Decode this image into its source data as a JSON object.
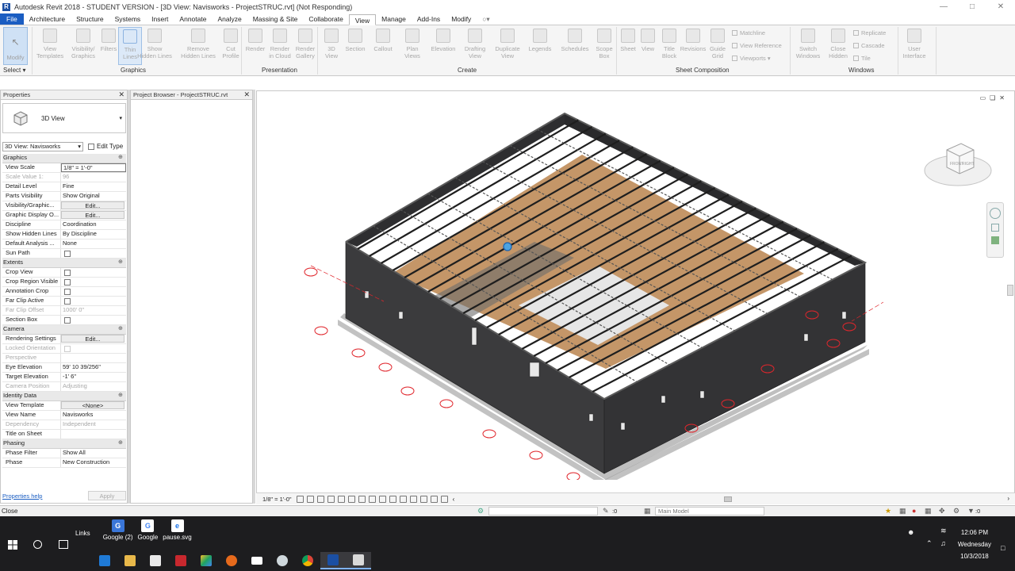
{
  "window": {
    "title": "Autodesk Revit 2018 - STUDENT VERSION - [3D View: Navisworks - ProjectSTRUC.rvt] (Not Responding)"
  },
  "ribbon_tabs": [
    "File",
    "Architecture",
    "Structure",
    "Systems",
    "Insert",
    "Annotate",
    "Analyze",
    "Massing & Site",
    "Collaborate",
    "View",
    "Manage",
    "Add-Ins",
    "Modify"
  ],
  "active_tab": "View",
  "ribbon": {
    "modify_label": "Modify",
    "select_label": "Select",
    "tools": {
      "view_templates": "View Templates",
      "visibility_graphics": "Visibility/ Graphics",
      "filters": "Filters",
      "thin_lines": "Thin Lines",
      "show_hidden_lines": "Show Hidden Lines",
      "remove_hidden_lines": "Remove Hidden Lines",
      "cut_profile": "Cut Profile",
      "render": "Render",
      "render_cloud": "Render in Cloud",
      "render_gallery": "Render Gallery",
      "view_3d": "3D View",
      "section": "Section",
      "callout": "Callout",
      "plan_views": "Plan Views",
      "elevation": "Elevation",
      "drafting_view": "Drafting View",
      "duplicate_view": "Duplicate View",
      "legends": "Legends",
      "schedules": "Schedules",
      "scope_box": "Scope Box",
      "sheet": "Sheet",
      "view": "View",
      "title_block": "Title Block",
      "revisions": "Revisions",
      "guide_grid": "Guide Grid",
      "matchline": "Matchline",
      "view_reference": "View Reference",
      "viewports": "Viewports",
      "switch_windows": "Switch Windows",
      "close_hidden": "Close Hidden",
      "replicate": "Replicate",
      "cascade": "Cascade",
      "tile": "Tile",
      "user_interface": "User Interface"
    },
    "groups": {
      "graphics": "Graphics",
      "presentation": "Presentation",
      "create": "Create",
      "sheet_composition": "Sheet Composition",
      "windows": "Windows"
    }
  },
  "properties": {
    "header": "Properties",
    "type_name": "3D View",
    "instance_selector": "3D View: Navisworks",
    "edit_type": "Edit Type",
    "rows": [
      {
        "kind": "section",
        "label": "Graphics"
      },
      {
        "label": "View Scale",
        "value": "1/8\" = 1'-0\"",
        "style": "boxed"
      },
      {
        "label": "Scale Value    1:",
        "value": "96",
        "style": "dim"
      },
      {
        "label": "Detail Level",
        "value": "Fine"
      },
      {
        "label": "Parts Visibility",
        "value": "Show Original"
      },
      {
        "label": "Visibility/Graphic...",
        "value": "Edit...",
        "style": "button"
      },
      {
        "label": "Graphic Display O...",
        "value": "Edit...",
        "style": "button"
      },
      {
        "label": "Discipline",
        "value": "Coordination"
      },
      {
        "label": "Show Hidden Lines",
        "value": "By Discipline"
      },
      {
        "label": "Default Analysis ...",
        "value": "None"
      },
      {
        "label": "Sun Path",
        "value": "",
        "style": "check"
      },
      {
        "kind": "section",
        "label": "Extents"
      },
      {
        "label": "Crop View",
        "value": "",
        "style": "check"
      },
      {
        "label": "Crop Region Visible",
        "value": "",
        "style": "check"
      },
      {
        "label": "Annotation Crop",
        "value": "",
        "style": "check"
      },
      {
        "label": "Far Clip Active",
        "value": "",
        "style": "check"
      },
      {
        "label": "Far Clip Offset",
        "value": "1000'  0\"",
        "style": "dim"
      },
      {
        "label": "Section Box",
        "value": "",
        "style": "check"
      },
      {
        "kind": "section",
        "label": "Camera"
      },
      {
        "label": "Rendering Settings",
        "value": "Edit...",
        "style": "button"
      },
      {
        "label": "Locked Orientation",
        "value": "",
        "style": "dimcheck"
      },
      {
        "label": "Perspective",
        "value": "",
        "style": "dim"
      },
      {
        "label": "Eye Elevation",
        "value": "59'  10 39/256\""
      },
      {
        "label": "Target Elevation",
        "value": "-1'  6\""
      },
      {
        "label": "Camera Position",
        "value": "Adjusting",
        "style": "dim"
      },
      {
        "kind": "section",
        "label": "Identity Data"
      },
      {
        "label": "View Template",
        "value": "<None>",
        "style": "button"
      },
      {
        "label": "View Name",
        "value": "Navisworks"
      },
      {
        "label": "Dependency",
        "value": "Independent",
        "style": "dim"
      },
      {
        "label": "Title on Sheet",
        "value": ""
      },
      {
        "kind": "section",
        "label": "Phasing"
      },
      {
        "label": "Phase Filter",
        "value": "Show All"
      },
      {
        "label": "Phase",
        "value": "New Construction"
      }
    ],
    "help_link": "Properties help",
    "apply_button": "Apply"
  },
  "project_browser": {
    "header": "Project Browser - ProjectSTRUC.rvt"
  },
  "view_control_bar": {
    "scale": "1/8\" = 1'-0\""
  },
  "status_bar": {
    "message": "Close",
    "workset_value": ":0",
    "design_option": "Main Model",
    "filter_count": ":0"
  },
  "taskbar": {
    "links_label": "Links",
    "links": [
      "Google (2)",
      "Google",
      "pause.svg"
    ],
    "time": "12:06 PM",
    "day": "Wednesday",
    "date": "10/3/2018"
  },
  "colors": {
    "file_tab": "#1a5dc2",
    "taskbar": "#1d1d1f",
    "wall": "#3b3b3d",
    "floor_wood": "#c49668",
    "grid_bubble": "#e0262c"
  }
}
